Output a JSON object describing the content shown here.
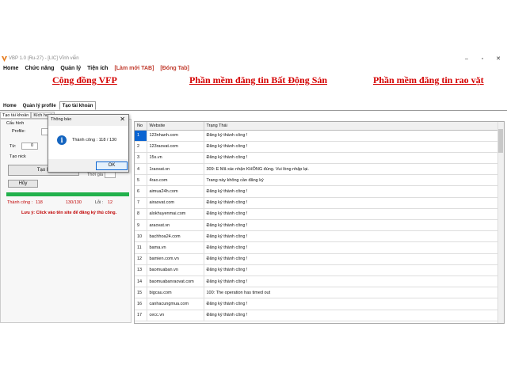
{
  "window": {
    "title": "VBP 1.0 (Ru-27) - [LIC] Vĩnh viễn",
    "minimize": "–",
    "maximize": "▫",
    "close": "✕"
  },
  "menu": {
    "items": [
      "Home",
      "Chức năng",
      "Quản lý",
      "Tiện ích",
      "[Làm mới TAB]",
      "[Đóng Tab]"
    ]
  },
  "banners": {
    "left": "Cộng đồng VFP",
    "center": "Phần mềm đăng tin Bất Động Sản",
    "right": "Phần mềm đăng tin rao vặt"
  },
  "tabs": [
    "Home",
    "Quản lý profile",
    "Tạo tài khoản"
  ],
  "subtabs": [
    "Tạo tài khoản",
    "Kích hoạt"
  ],
  "left": {
    "config_label": "Cấu hình",
    "profile_label": "Profile:",
    "from_label": "Từ:",
    "from_value": "0",
    "create_nick_label": "Tạo nick",
    "create_button": "Tạo N",
    "delay_label": "Thời gia",
    "cancel_button": "Hủy",
    "progress_percent": 100,
    "stats": {
      "success_label": "Thành công :",
      "success_value": "118",
      "done_value": "130/130",
      "error_label": "Lỗi :",
      "error_value": "12"
    },
    "note": "Lưu ý: Click vào tên site để đăng ký thủ công."
  },
  "dialog": {
    "title": "Thông báo",
    "close": "✕",
    "icon": "info-icon",
    "message": "Thành công : 118 / 130",
    "ok": "OK"
  },
  "grid": {
    "headers": [
      "No",
      "Website",
      "Trạng Thái"
    ],
    "rows": [
      [
        "1",
        "123nhanh.com",
        "Đăng ký thành công !"
      ],
      [
        "2",
        "123raovat.com",
        "Đăng ký thành công !"
      ],
      [
        "3",
        "15s.vn",
        "Đăng ký thành công !"
      ],
      [
        "4",
        "1raovat.vn",
        "309: E Mã xác nhận KHÔNG đúng. Vui lòng nhập lại."
      ],
      [
        "5",
        "4rao.com",
        "Trang này không cần đăng ký"
      ],
      [
        "6",
        "aimua24h.com",
        "Đăng ký thành công !"
      ],
      [
        "7",
        "airaovat.com",
        "Đăng ký thành công !"
      ],
      [
        "8",
        "alokhuyenmai.com",
        "Đăng ký thành công !"
      ],
      [
        "9",
        "araovat.vn",
        "Đăng ký thành công !"
      ],
      [
        "10",
        "bachhoa24.com",
        "Đăng ký thành công !"
      ],
      [
        "11",
        "bama.vn",
        "Đăng ký thành công !"
      ],
      [
        "12",
        "bamien.com.vn",
        "Đăng ký thành công !"
      ],
      [
        "13",
        "baomuaban.vn",
        "Đăng ký thành công !"
      ],
      [
        "14",
        "baomuabanraovat.com",
        "Đăng ký thành công !"
      ],
      [
        "15",
        "bigcau.com",
        "100: The operation has timed out"
      ],
      [
        "16",
        "canhacungmua.com",
        "Đăng ký thành công !"
      ],
      [
        "17",
        "cecc.vn",
        "Đăng ký thành công !"
      ]
    ]
  },
  "colors": {
    "banner_red": "#d40000",
    "progress_green": "#22b14c",
    "selection_blue": "#0a64d2",
    "note_red": "#c00000"
  }
}
